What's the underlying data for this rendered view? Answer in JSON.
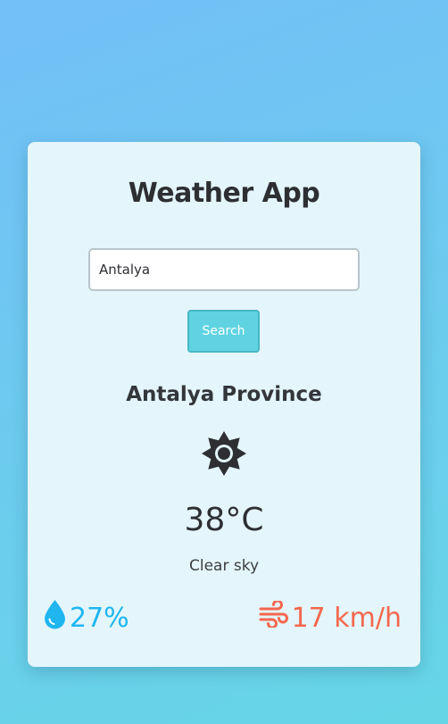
{
  "app": {
    "title": "Weather App"
  },
  "search": {
    "value": "Antalya",
    "button_label": "Search"
  },
  "weather": {
    "location": "Antalya Province",
    "icon": "sun-icon",
    "temperature": "38°C",
    "description": "Clear sky",
    "humidity": "27%",
    "humidity_icon": "water-drop-icon",
    "wind": "17 km/h",
    "wind_icon": "wind-icon"
  },
  "colors": {
    "card_background": "#e4f6fc",
    "button": "#5fd3e1",
    "humidity": "#1fb6f0",
    "wind": "#f4674d",
    "text": "#2d2f33"
  }
}
